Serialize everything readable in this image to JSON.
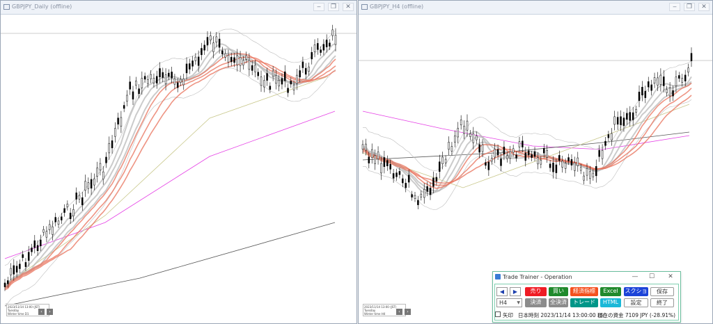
{
  "left_window": {
    "title": "GBPJPY_Daily (offline)",
    "info_lines": [
      "2023/11/14 13:00 (JST)",
      "Tuesday",
      "Winter time     D1"
    ],
    "buttons": {
      "minimize": "‒",
      "restore": "❐",
      "close": "✕"
    }
  },
  "right_window": {
    "title": "GBPJPY_H4 (offline)",
    "info_lines": [
      "2023/11/14 13:00 (JST)",
      "Tuesday",
      "Winter time     H4"
    ],
    "buttons": {
      "minimize": "‒",
      "restore": "❐",
      "close": "✕"
    }
  },
  "trade_trainer": {
    "title": "Trade Trainer - Operation",
    "controls": {
      "minimize": "—",
      "maximize": "☐",
      "close": "✕"
    },
    "prev_label": "◀",
    "next_label": "▶",
    "row1": {
      "sell": "売り",
      "buy": "買い",
      "indicators": "経済指標",
      "excel": "Excel",
      "screenshot": "スクショ",
      "save": "保存"
    },
    "row2": {
      "settle": "決済",
      "settle_all": "全決済",
      "trade": "トレード",
      "html": "HTML",
      "settings": "設定",
      "exit": "終了"
    },
    "timeframe": "H4",
    "arrow_label": "矢印",
    "jp_time": "日本時刻 2023/11/14 13:00:00 (火)",
    "balance": "現在の資金 7109 JPY (-28.91%)"
  },
  "colors": {
    "bull": "#000000",
    "bear": "#000000",
    "ema_red": "#e8705a",
    "ema_gray": "#b5b5b5",
    "bb": "#bdbdbd",
    "ma_magenta": "#e53fe5",
    "ma_dark": "#555555",
    "ma_olive": "#c8c78a"
  }
}
